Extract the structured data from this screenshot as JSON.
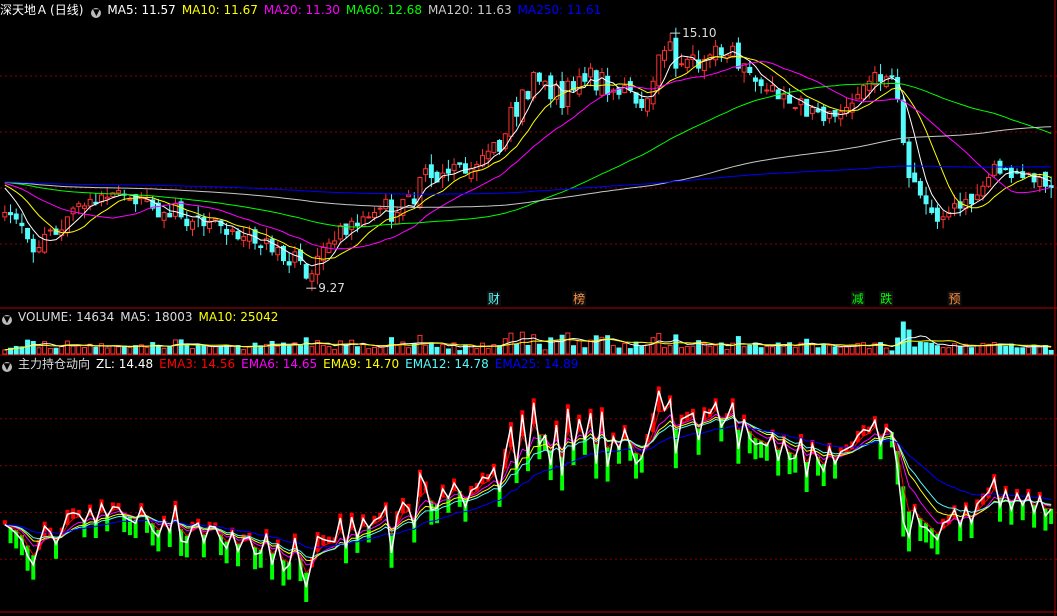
{
  "colors": {
    "background": "#000000",
    "up": "#FF3232",
    "down": "#54FCFC",
    "grid": "#8B0000",
    "separator": "#B00000"
  },
  "price_panel": {
    "stock_name": "深天地Ａ",
    "period": "(日线)",
    "ma_labels": [
      {
        "text": "MA5: 11.57",
        "color": "#FFFFFF"
      },
      {
        "text": "MA10: 11.67",
        "color": "#FFFF00"
      },
      {
        "text": "MA20: 11.30",
        "color": "#FF00FF"
      },
      {
        "text": "MA60: 12.68",
        "color": "#00FF00"
      },
      {
        "text": "MA120: 11.63",
        "color": "#C8C8C8"
      },
      {
        "text": "MA250: 11.61",
        "color": "#0000FF"
      }
    ],
    "high_label": "15.10",
    "low_label": "9.27",
    "event_tags": [
      {
        "text": "财",
        "color": "#54FCFC",
        "x_index": 86
      },
      {
        "text": "榜",
        "color": "#FF9040",
        "x_index": 101
      },
      {
        "text": "减",
        "color": "#00FF00",
        "x_index": 150
      },
      {
        "text": "跌",
        "color": "#00FF00",
        "x_index": 155
      },
      {
        "text": "预",
        "color": "#FF9040",
        "x_index": 167
      }
    ]
  },
  "volume_panel": {
    "labels": [
      {
        "text": "VOLUME: 14634",
        "color": "#DDDDDD"
      },
      {
        "text": "MA5: 18003",
        "color": "#DDDDDD"
      },
      {
        "text": "MA10: 25042",
        "color": "#FFFF00"
      }
    ]
  },
  "indicator_panel": {
    "labels": [
      {
        "text": "主力持仓动向",
        "color": "#DDDDDD"
      },
      {
        "text": "ZL: 14.48",
        "color": "#FFFFFF"
      },
      {
        "text": "EMA3: 14.56",
        "color": "#FF0000"
      },
      {
        "text": "EMA6: 14.65",
        "color": "#FF00FF"
      },
      {
        "text": "EMA9: 14.70",
        "color": "#FFFF00"
      },
      {
        "text": "EMA12: 14.78",
        "color": "#54FCFC"
      },
      {
        "text": "EMA25: 14.89",
        "color": "#0000FF"
      }
    ]
  },
  "chart_data": {
    "type": "candlestick",
    "price_range": [
      9.0,
      15.4
    ],
    "high": 15.1,
    "low": 9.27,
    "close_series": [
      11.0,
      10.95,
      10.85,
      10.7,
      10.4,
      10.1,
      10.2,
      10.5,
      10.6,
      10.5,
      10.6,
      10.9,
      11.1,
      11.2,
      11.15,
      11.3,
      11.2,
      11.4,
      11.35,
      11.45,
      11.5,
      11.4,
      11.3,
      11.2,
      11.35,
      11.3,
      11.1,
      10.9,
      11.0,
      10.9,
      11.2,
      10.9,
      10.7,
      10.8,
      10.9,
      10.7,
      10.8,
      10.85,
      10.7,
      10.5,
      10.6,
      10.4,
      10.45,
      10.5,
      10.3,
      10.2,
      10.4,
      10.1,
      10.2,
      9.9,
      9.8,
      10.1,
      9.9,
      9.5,
      9.6,
      10.0,
      10.2,
      10.3,
      10.35,
      10.7,
      10.5,
      10.8,
      10.7,
      10.9,
      10.9,
      11.0,
      11.1,
      11.3,
      10.8,
      11.0,
      11.3,
      11.4,
      11.2,
      11.8,
      12.0,
      11.8,
      11.7,
      11.9,
      11.9,
      12.1,
      12.1,
      11.9,
      12.0,
      12.1,
      12.3,
      12.4,
      12.6,
      12.4,
      12.8,
      13.4,
      13.2,
      13.8,
      13.6,
      14.2,
      14.0,
      14.0,
      13.6,
      13.9,
      13.4,
      14.0,
      13.8,
      14.1,
      14.0,
      14.3,
      13.8,
      14.2,
      13.7,
      13.8,
      13.7,
      13.9,
      13.8,
      13.5,
      13.4,
      13.6,
      14.0,
      14.6,
      14.7,
      14.9,
      14.3,
      14.4,
      14.5,
      14.6,
      14.3,
      14.5,
      14.6,
      14.8,
      14.6,
      14.6,
      14.8,
      14.3,
      14.4,
      14.2,
      14.0,
      13.9,
      13.8,
      13.9,
      13.6,
      13.7,
      13.5,
      13.4,
      13.6,
      13.2,
      13.4,
      13.3,
      13.1,
      13.3,
      13.2,
      13.3,
      13.4,
      13.5,
      13.7,
      13.9,
      14.0,
      14.2,
      14.0,
      14.1,
      14.1,
      13.6,
      12.6,
      11.8,
      11.7,
      11.4,
      11.2,
      11.0,
      10.8,
      10.9,
      11.0,
      11.2,
      11.1,
      11.3,
      11.2,
      11.4,
      11.6,
      11.8,
      12.1,
      11.9,
      12.0,
      11.8,
      11.9,
      11.8,
      11.9,
      11.7,
      11.8,
      11.6,
      11.57
    ],
    "ma_series": {
      "MA5": 11.57,
      "MA10": 11.67,
      "MA20": 11.3,
      "MA60": 12.68,
      "MA120": 11.63,
      "MA250": 11.61
    },
    "volume_last": 14634,
    "volume_ma5": 18003,
    "volume_ma10": 25042,
    "indicator": {
      "name": "主力持仓动向",
      "ZL": 14.48,
      "EMA3": 14.56,
      "EMA6": 14.65,
      "EMA9": 14.7,
      "EMA12": 14.78,
      "EMA25": 14.89
    }
  }
}
